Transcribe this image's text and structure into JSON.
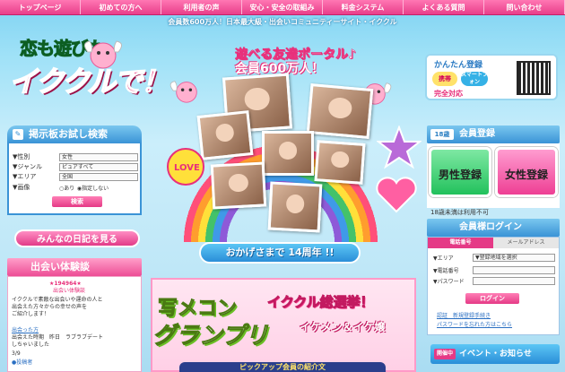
{
  "nav": {
    "items": [
      {
        "label": "トップページ"
      },
      {
        "label": "初めての方へ"
      },
      {
        "label": "利用者の声"
      },
      {
        "label": "安心・安全の取組み"
      },
      {
        "label": "料金システム"
      },
      {
        "label": "よくある質問"
      },
      {
        "label": "問い合わせ"
      }
    ]
  },
  "header": {
    "tagline": "会員数600万人！日本最大級・出会いコミュニティーサイト・イククル",
    "logo_top": "恋も遊びも",
    "logo_main": "イククルで！"
  },
  "banner": {
    "line1": "遊べる友達ポータル♪",
    "line2": "会員600万人！",
    "anniversary": "おかげさまで 14周年 !!"
  },
  "register_box": {
    "title": "かんたん登録",
    "chip1": "携帯",
    "chip2": "スマートフォン",
    "bottom": "完全対応"
  },
  "search": {
    "title": "掲示板お試し検索",
    "rows": [
      {
        "label": "▼性別",
        "value": "女性"
      },
      {
        "label": "▼ジャンル",
        "value": "ピュアすべて"
      },
      {
        "label": "▼エリア",
        "value": "全国"
      }
    ],
    "image_label": "▼画像",
    "radio1": "あり",
    "radio2": "指定しない",
    "button": "検索"
  },
  "diary": {
    "label": "みんなの日記を見る"
  },
  "taiken": {
    "title": "出会い体験談",
    "lines": [
      "★194964★",
      "出会い体験談",
      "イククルで素敵な出会いや運命の人と",
      "出会えた方々からの幸せの声を",
      "ご紹介します！",
      "",
      "出会った方",
      "出会えた時期　昨日　ラブラブデート",
      "しちゃいました",
      "3/9",
      "●投稿者"
    ]
  },
  "member": {
    "tag": "18歳",
    "title": "会員登録",
    "male": "男性登録",
    "female": "女性登録",
    "note": "18歳未満は利用不可"
  },
  "login": {
    "title": "会員様ログイン",
    "tab1": "電話番号",
    "tab2": "メールアドレス",
    "area_label": "▼エリア",
    "area_value": "▼登録地域を選択",
    "phone_label": "▼電話番号",
    "pw_label": "▼パスワード",
    "button": "ログイン",
    "link1": "認証　新規登録手続き",
    "link2": "パスワードを忘れた方はこちら"
  },
  "event": {
    "tag": "開催中",
    "title": "イベント・お知らせ"
  },
  "grandprix": {
    "l1": "写メコン",
    "l2": "グランプリ",
    "l3": "イククル総選挙！",
    "l4": "イケメン＆イケ嬢",
    "bar": "ピックアップ会員の紹介文"
  },
  "colors": {
    "nav": "#e93e8a",
    "accent_blue": "#3a93d6",
    "male": "#22c15c",
    "female": "#ee3f94"
  }
}
